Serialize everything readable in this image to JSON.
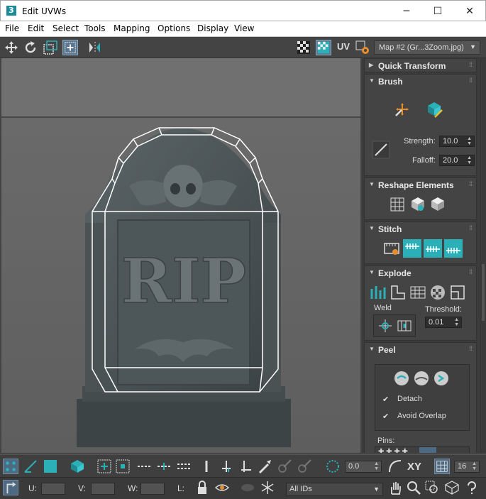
{
  "window": {
    "title": "Edit UVWs",
    "app_icon": "3",
    "minimize": "─",
    "maximize": "☐",
    "close": "✕"
  },
  "menu": [
    "File",
    "Edit",
    "Select",
    "Tools",
    "Mapping",
    "Options",
    "Display",
    "View"
  ],
  "toolbar": {
    "uv_label": "UV",
    "map_select": "Map #2 (Gr...3Zoom.jpg)"
  },
  "viewport": {
    "model_text": "RIP"
  },
  "panel": {
    "quick_transform": "Quick Transform",
    "brush": {
      "title": "Brush",
      "strength_label": "Strength:",
      "strength_value": "10.0",
      "falloff_label": "Falloff:",
      "falloff_value": "20.0"
    },
    "reshape": {
      "title": "Reshape Elements"
    },
    "stitch": {
      "title": "Stitch"
    },
    "explode": {
      "title": "Explode",
      "weld_label": "Weld",
      "threshold_label": "Threshold:",
      "threshold_value": "0.01"
    },
    "peel": {
      "title": "Peel",
      "detach_label": "Detach",
      "detach_checked": true,
      "avoid_overlap_label": "Avoid Overlap",
      "avoid_overlap_checked": true,
      "pins_label": "Pins:"
    }
  },
  "bottom": {
    "rotate_value": "0.0",
    "xy_label": "XY",
    "grid_value": "16",
    "u_label": "U:",
    "v_label": "V:",
    "w_label": "W:",
    "l_label": "L:",
    "ids_select": "All IDs"
  },
  "colors": {
    "accent_teal": "#2bb0b8",
    "panel_bg": "#444444",
    "selection_blue": "#4e6a83",
    "wire": "#ffffff"
  }
}
